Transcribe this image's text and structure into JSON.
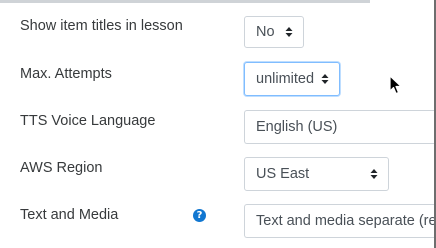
{
  "settings": {
    "rows": [
      {
        "label": "Show item titles in lesson",
        "value": "No"
      },
      {
        "label": "Max. Attempts",
        "value": "unlimited"
      },
      {
        "label": "TTS Voice Language",
        "value": "English (US)"
      },
      {
        "label": "AWS Region",
        "value": "US East"
      },
      {
        "label": "Text and Media",
        "value": "Text and media separate (rec"
      }
    ]
  },
  "icons": {
    "select_caret": "up-down-caret-icon",
    "help": "question-circle-icon",
    "help_glyph": "?",
    "pointer": "mouse-cursor-icon"
  },
  "colors": {
    "help_icon": "#1177d1",
    "focus_border": "#80bdff",
    "control_border": "#ced4da",
    "label_text": "#373a3c"
  }
}
